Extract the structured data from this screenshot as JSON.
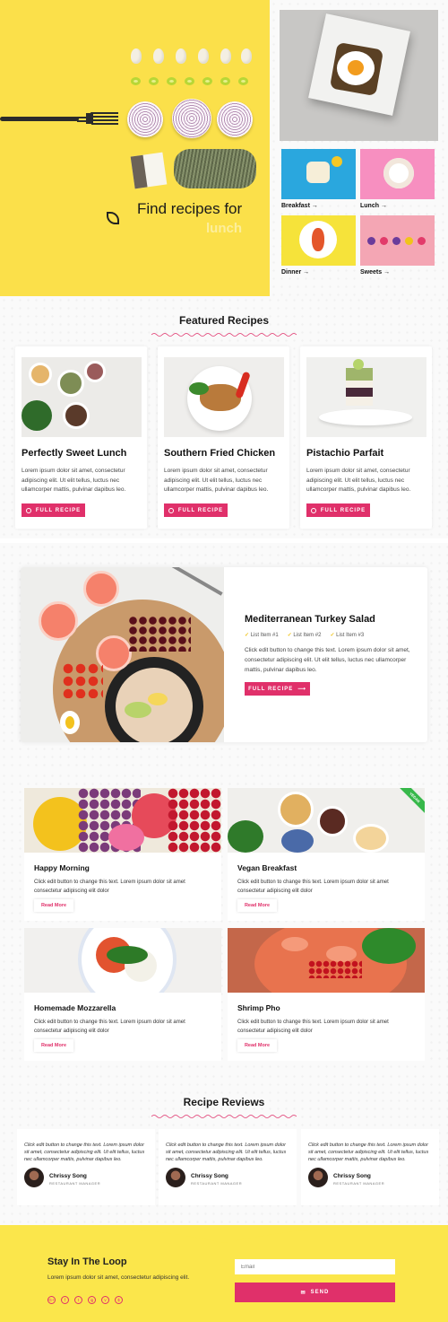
{
  "hero": {
    "headline": "Find recipes for",
    "rotating_word": "lunch",
    "categories": [
      {
        "label": "Breakfast →"
      },
      {
        "label": "Lunch →"
      },
      {
        "label": "Dinner →"
      },
      {
        "label": "Sweets →"
      }
    ]
  },
  "featured": {
    "title": "Featured Recipes",
    "cards": [
      {
        "title": "Perfectly Sweet Lunch",
        "text": "Lorem ipsum dolor sit amet, consectetur adipiscing elit. Ut elit tellus, luctus nec ullamcorper mattis, pulvinar dapibus leo.",
        "button": "FULL RECIPE"
      },
      {
        "title": "Southern Fried Chicken",
        "text": "Lorem ipsum dolor sit amet, consectetur adipiscing elit. Ut elit tellus, luctus nec ullamcorper mattis, pulvinar dapibus leo.",
        "button": "FULL RECIPE"
      },
      {
        "title": "Pistachio Parfait",
        "text": "Lorem ipsum dolor sit amet, consectetur adipiscing elit. Ut elit tellus, luctus nec ullamcorper mattis, pulvinar dapibus leo.",
        "button": "FULL RECIPE"
      }
    ]
  },
  "highlight": {
    "title": "Mediterranean Turkey Salad",
    "list": [
      "List Item #1",
      "List Item #2",
      "List Item #3"
    ],
    "text": "Click edit button to change this text. Lorem ipsum dolor sit amet, consectetur adipiscing elit. Ut elit tellus, luctus nec ullamcorper mattis, pulvinar dapibus leo.",
    "button": "FULL RECIPE"
  },
  "grid": {
    "badge": "VEGAN",
    "items": [
      {
        "title": "Happy Morning",
        "text": "Click edit button to change this text. Lorem ipsum dolor sit amet consectetur adipiscing elit dolor",
        "link": "Read More"
      },
      {
        "title": "Vegan Breakfast",
        "text": "Click edit button to change this text. Lorem ipsum dolor sit amet consectetur adipiscing elit dolor",
        "link": "Read More"
      },
      {
        "title": "Homemade Mozzarella",
        "text": "Click edit button to change this text. Lorem ipsum dolor sit amet consectetur adipiscing elit dolor",
        "link": "Read More"
      },
      {
        "title": "Shrimp Pho",
        "text": "Click edit button to change this text. Lorem ipsum dolor sit amet consectetur adipiscing elit dolor",
        "link": "Read More"
      }
    ]
  },
  "reviews": {
    "title": "Recipe Reviews",
    "items": [
      {
        "text": "Click edit button to change this text. Lorem ipsum dolor sit amet, consectetur adipiscing elit. Ut elit tellus, luctus nec ullamcorper mattis, pulvinar dapibus leo.",
        "name": "Chrissy Song",
        "role": "RESTAURANT MANAGER"
      },
      {
        "text": "Click edit button to change this text. Lorem ipsum dolor sit amet, consectetur adipiscing elit. Ut elit tellus, luctus nec ullamcorper mattis, pulvinar dapibus leo.",
        "name": "Chrissy Song",
        "role": "RESTAURANT MANAGER"
      },
      {
        "text": "Click edit button to change this text. Lorem ipsum dolor sit amet, consectetur adipiscing elit. Ut elit tellus, luctus nec ullamcorper mattis, pulvinar dapibus leo.",
        "name": "Chrissy Song",
        "role": "RESTAURANT MANAGER"
      }
    ]
  },
  "footer": {
    "title": "Stay In The Loop",
    "text": "Lorem ipsum dolor sit amet, consectetur adipiscing elit.",
    "email_placeholder": "Email",
    "send": "SEND",
    "socials": [
      "G+",
      "f",
      "t",
      "ig",
      "v",
      "$"
    ]
  },
  "colors": {
    "accent": "#e0306a",
    "yellow": "#fbe04a",
    "green": "#37b84a"
  }
}
